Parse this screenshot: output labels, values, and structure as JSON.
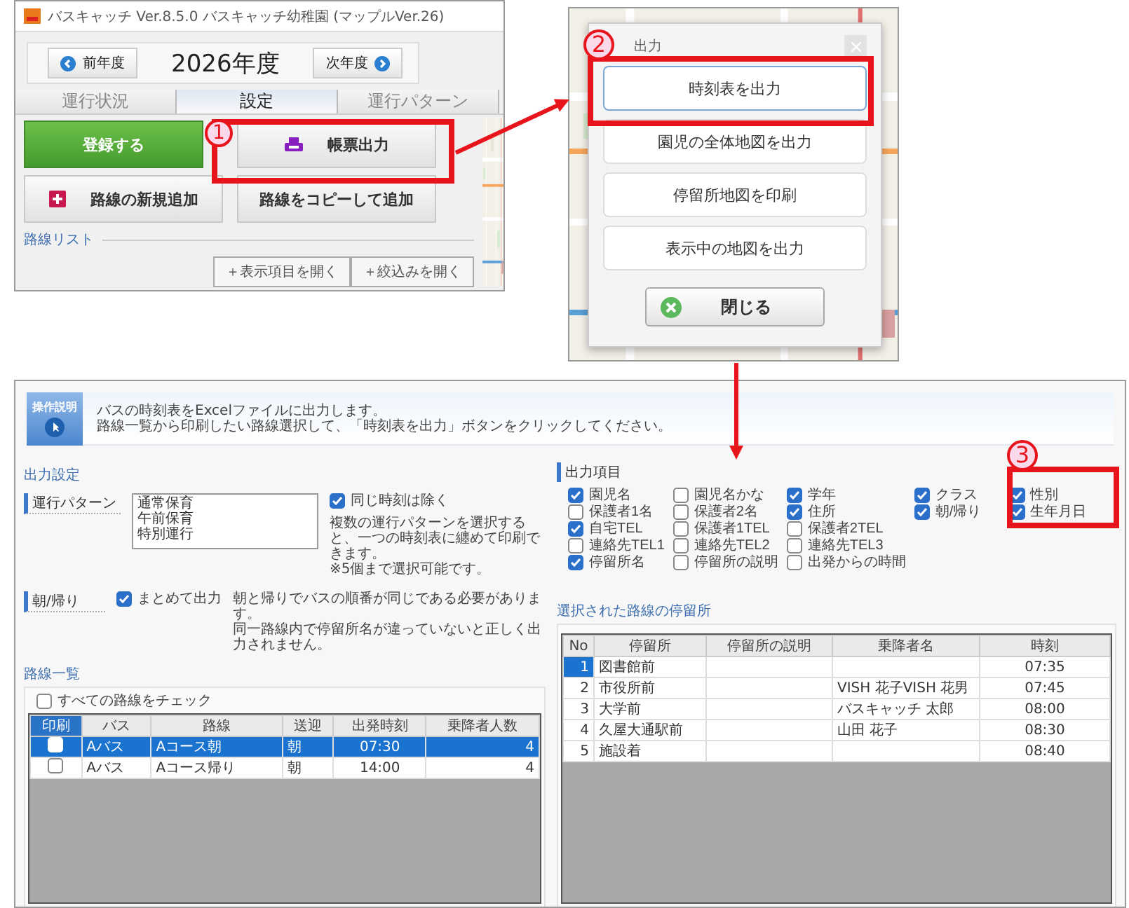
{
  "main_window": {
    "title": "バスキャッチ Ver.8.5.0 バスキャッチ幼稚園 (マップルVer.26)",
    "prev_year": "前年度",
    "year": "2026年度",
    "next_year": "次年度",
    "tabs": [
      {
        "label": "運行状況",
        "selected": false
      },
      {
        "label": "設定",
        "selected": true
      },
      {
        "label": "運行パターン",
        "selected": false
      }
    ],
    "register_button": "登録する",
    "print_button": "帳票出力",
    "add_route_button": "路線の新規追加",
    "copy_route_button": "路線をコピーして追加",
    "route_list_label": "路線リスト",
    "route_list_buttons": [
      "＋表示項目を開く",
      "＋絞込みを開く"
    ],
    "callout": "1"
  },
  "output_dialog": {
    "title": "出力",
    "callout": "2",
    "buttons": [
      "時刻表を出力",
      "園児の全体地図を出力",
      "停留所地図を印刷",
      "表示中の地図を出力"
    ],
    "close_button": "閉じる"
  },
  "timetable_window": {
    "help_label": "操作説明",
    "help_text": [
      "バスの時刻表をExcelファイルに出力します。",
      "路線一覧から印刷したい路線選択して、「時刻表を出力」ボタンをクリックしてください。"
    ],
    "settings_title": "出力設定",
    "pattern_label": "運行パターン",
    "patterns": [
      "通常保育",
      "午前保育",
      "特別運行"
    ],
    "exclude_same_time": {
      "label": "同じ時刻は除く",
      "checked": true
    },
    "pattern_note": [
      "複数の運行パターンを選択すると、一つの時刻表に纏めて印刷できます。",
      "※5個まで選択可能です。"
    ],
    "direction_label": "朝/帰り",
    "combine": {
      "label": "まとめて出力",
      "checked": true
    },
    "direction_note": [
      "朝と帰りでバスの順番が同じである必要があります。",
      "同一路線内で停留所名が違っていないと正しく出力されません。"
    ],
    "items_title": "出力項目",
    "callout": "3",
    "item_columns": [
      [
        {
          "label": "園児名",
          "checked": true
        },
        {
          "label": "保護者1名",
          "checked": false
        },
        {
          "label": "自宅TEL",
          "checked": true
        },
        {
          "label": "連絡先TEL1",
          "checked": false
        },
        {
          "label": "停留所名",
          "checked": true
        }
      ],
      [
        {
          "label": "園児名かな",
          "checked": false
        },
        {
          "label": "保護者2名",
          "checked": false
        },
        {
          "label": "保護者1TEL",
          "checked": false
        },
        {
          "label": "連絡先TEL2",
          "checked": false
        },
        {
          "label": "停留所の説明",
          "checked": false
        }
      ],
      [
        {
          "label": "学年",
          "checked": true
        },
        {
          "label": "住所",
          "checked": true
        },
        {
          "label": "保護者2TEL",
          "checked": false
        },
        {
          "label": "連絡先TEL3",
          "checked": false
        },
        {
          "label": "出発からの時間",
          "checked": false
        }
      ],
      [
        {
          "label": "クラス",
          "checked": true
        },
        {
          "label": "朝/帰り",
          "checked": true
        }
      ],
      [
        {
          "label": "性別",
          "checked": true
        },
        {
          "label": "生年月日",
          "checked": true
        }
      ]
    ],
    "routes": {
      "title": "路線一覧",
      "check_all": {
        "label": "すべての路線をチェック",
        "checked": false
      },
      "columns": [
        "印刷",
        "バス",
        "路線",
        "送迎",
        "出発時刻",
        "乗降者人数"
      ],
      "rows": [
        {
          "checked": false,
          "selected": true,
          "bus": "Aバス",
          "route": "Aコース朝",
          "pickup": "朝",
          "departure": "07:30",
          "riders": "4"
        },
        {
          "checked": false,
          "selected": false,
          "bus": "Aバス",
          "route": "Aコース帰り",
          "pickup": "朝",
          "departure": "14:00",
          "riders": "4"
        }
      ]
    },
    "stops": {
      "title": "選択された路線の停留所",
      "columns": [
        "No",
        "停留所",
        "停留所の説明",
        "乗降者名",
        "時刻"
      ],
      "rows": [
        {
          "no": "1",
          "selected": true,
          "stop": "図書館前",
          "riders": "",
          "time": "07:35"
        },
        {
          "no": "2",
          "selected": false,
          "stop": "市役所前",
          "riders": "VISH 花子VISH 花男",
          "time": "07:45"
        },
        {
          "no": "3",
          "selected": false,
          "stop": "大学前",
          "riders": "バスキャッチ 太郎",
          "time": "08:00"
        },
        {
          "no": "4",
          "selected": false,
          "stop": "久屋大通駅前",
          "riders": "山田 花子",
          "time": "08:30"
        },
        {
          "no": "5",
          "selected": false,
          "stop": "施設着",
          "riders": "",
          "time": "08:40"
        }
      ]
    }
  }
}
